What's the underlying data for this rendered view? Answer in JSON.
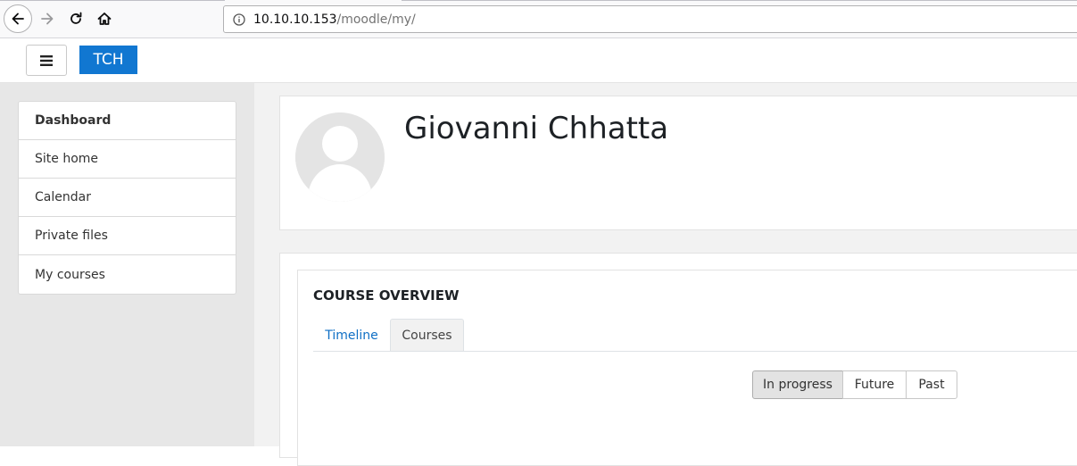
{
  "browser": {
    "url_host": "10.10.10.153",
    "url_path": "/moodle/my/",
    "icons": [
      "back-arrow-icon",
      "forward-arrow-icon",
      "reload-icon",
      "home-icon",
      "info-icon"
    ]
  },
  "navbar": {
    "brand": "TCH",
    "menu_icon": "hamburger-icon",
    "brand_color": "#1177d1"
  },
  "drawer": {
    "items": [
      {
        "label": "Dashboard",
        "active": true
      },
      {
        "label": "Site home"
      },
      {
        "label": "Calendar"
      },
      {
        "label": "Private files"
      },
      {
        "label": "My courses"
      }
    ]
  },
  "profile": {
    "name": "Giovanni Chhatta",
    "avatar_icon": "default-user-avatar"
  },
  "course_overview": {
    "title": "COURSE OVERVIEW",
    "tabs": [
      {
        "label": "Timeline"
      },
      {
        "label": "Courses",
        "selected": true
      }
    ],
    "filters": [
      {
        "label": "In progress",
        "selected": true
      },
      {
        "label": "Future"
      },
      {
        "label": "Past"
      }
    ],
    "link_color": "#0f6fc5"
  }
}
